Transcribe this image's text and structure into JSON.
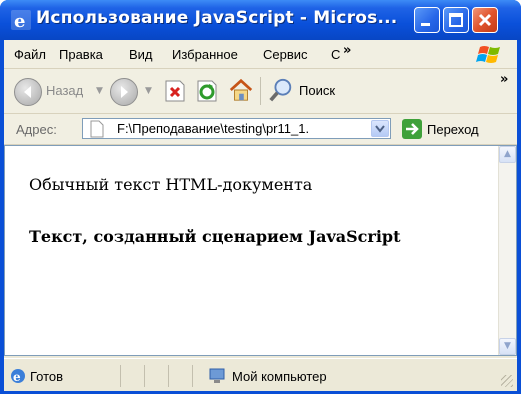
{
  "window": {
    "title": "Использование JavaScript - Micros...",
    "controls": {
      "minimize": "minimize",
      "maximize": "maximize",
      "close": "close"
    }
  },
  "menu": {
    "items": [
      "Файл",
      "Правка",
      "Вид",
      "Избранное",
      "Сервис",
      "С"
    ],
    "overflow": "»"
  },
  "toolbar": {
    "back_label": "Назад",
    "search_label": "Поиск",
    "overflow": "»"
  },
  "address": {
    "label": "Адрес:",
    "value": "F:\\Преподавание\\testing\\pr11_1.",
    "go_label": "Переход"
  },
  "page": {
    "paragraph1": "Обычный текст HTML-документа",
    "paragraph2": "Текст, созданный сценарием JavaScript"
  },
  "status": {
    "left": "Готов",
    "zone": "Мой компьютер"
  },
  "colors": {
    "titlebar": "#0a50da",
    "chrome": "#ece9d8",
    "go_green": "#3fa13a"
  }
}
